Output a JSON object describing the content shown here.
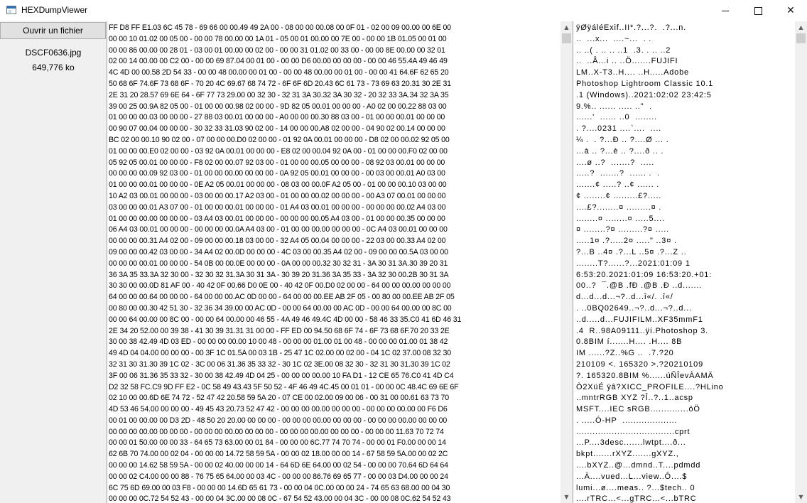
{
  "window": {
    "title": "HEXDumpViewer",
    "controls": {
      "minimize": "",
      "maximize": "",
      "close": "✕"
    }
  },
  "sidebar": {
    "open_button_label": "Ouvrir un fichier",
    "file_name": "DSCF0636.jpg",
    "file_size": "649,776 ko"
  },
  "hex_lines": [
    "FF D8 FF E1.03 6C 45 78 - 69 66 00 00.49 49 2A 00 - 08 00 00 00.08 00 0F 01 - 02 00 09 00.00 00 6E 00",
    "00 00 10 01.02 00 05 00 - 00 00 78 00.00 00 1A 01 - 05 00 01 00.00 00 7E 00 - 00 00 1B 01.05 00 01 00",
    "00 00 86 00.00 00 28 01 - 03 00 01 00.00 00 02 00 - 00 00 31 01.02 00 33 00 - 00 00 8E 00.00 00 32 01",
    "02 00 14 00.00 00 C2 00 - 00 00 69 87.04 00 01 00 - 00 00 D6 00.00 00 00 00 - 00 00 46 55.4A 49 46 49",
    "4C 4D 00 00.58 2D 54 33 - 00 00 48 00.00 00 01 00 - 00 00 48 00.00 00 01 00 - 00 00 41 64.6F 62 65 20",
    "50 68 6F 74.6F 73 68 6F - 70 20 4C 69.67 68 74 72 - 6F 6F 6D 20.43 6C 61 73 - 73 69 63 20.31 30 2E 31",
    "2E 31 20 28.57 69 6E 64 - 6F 77 73 29.00 00 32 30 - 32 31 3A 30.32 3A 30 32 - 20 32 33 3A.34 32 3A 35",
    "39 00 25 00.9A 82 05 00 - 01 00 00 00.98 02 00 00 - 9D 82 05 00.01 00 00 00 - A0 02 00 00.22 88 03 00",
    "01 00 00 00.03 00 00 00 - 27 88 03 00.01 00 00 00 - A0 00 00 00.30 88 03 00 - 01 00 00 00.01 00 00 00",
    "00 90 07 00.04 00 00 00 - 30 32 33 31.03 90 02 00 - 14 00 00 00.A8 02 00 00 - 04 90 02 00.14 00 00 00",
    "BC 02 00 00.10 90 02 00 - 07 00 00 00.D0 02 00 00 - 01 92 0A 00.01 00 00 00 - D8 02 00 00.02 92 05 00",
    "01 00 00 00.E0 02 00 00 - 03 92 0A 00.01 00 00 00 - E8 02 00 00.04 92 0A 00 - 01 00 00 00.F0 02 00 00",
    "05 92 05 00.01 00 00 00 - F8 02 00 00.07 92 03 00 - 01 00 00 00.05 00 00 00 - 08 92 03 00.01 00 00 00",
    "00 00 00 00.09 92 03 00 - 01 00 00 00.00 00 00 00 - 0A 92 05 00.01 00 00 00 - 00 03 00 00.01 A0 03 00",
    "01 00 00 00.01 00 00 00 - 0E A2 05 00.01 00 00 00 - 08 03 00 00.0F A2 05 00 - 01 00 00 00.10 03 00 00",
    "10 A2 03 00.01 00 00 00 - 03 00 00 00.17 A2 03 00 - 01 00 00 00.02 00 00 00 - 00 A3 07 00.01 00 00 00",
    "03 00 00 00.01 A3 07 00 - 01 00 00 00.01 00 00 00 - 01 A4 03 00.01 00 00 00 - 00 00 00 00.02 A4 03 00",
    "01 00 00 00.00 00 00 00 - 03 A4 03 00.01 00 00 00 - 00 00 00 00.05 A4 03 00 - 01 00 00 00.35 00 00 00",
    "06 A4 03 00.01 00 00 00 - 00 00 00 00.0A A4 03 00 - 01 00 00 00.00 00 00 00 - 0C A4 03 00.01 00 00 00",
    "00 00 00 00.31 A4 02 00 - 09 00 00 00.18 03 00 00 - 32 A4 05 00.04 00 00 00 - 22 03 00 00.33 A4 02 00",
    "09 00 00 00.42 03 00 00 - 34 A4 02 00.0D 00 00 00 - 4C 03 00 00.35 A4 02 00 - 09 00 00 00.5A 03 00 00",
    "00 00 00 00.01 00 00 00 - 54 0B 00 00.0E 00 00 00 - 0A 00 00 00.32 30 32 31 - 3A 30 31 3A.30 39 20 31",
    "36 3A 35 33.3A 32 30 00 - 32 30 32 31.3A 30 31 3A - 30 39 20 31.36 3A 35 33 - 3A 32 30 00.2B 30 31 3A",
    "30 30 00 00.0D 81 AF 00 - 40 42 0F 00.66 D0 0E 00 - 40 42 0F 00.D0 02 00 00 - 64 00 00 00.00 00 00 00",
    "64 00 00 00.64 00 00 00 - 64 00 00 00.AC 0D 00 00 - 64 00 00 00.EE AB 2F 05 - 00 80 00 00.EE AB 2F 05",
    "00 80 00 00.30 42 51 30 - 32 36 34 39.00 00 AC 0D - 00 00 64 00.00 00 AC 0D - 00 00 64 00.00 00 8C 00",
    "00 00 64 00.00 00 8C 00 - 00 00 64 00.00 00 46 55 - 4A 49 46 49.4C 4D 00 00 - 58 46 33 35.C0 41 6D 46 31",
    "2E 34 20 52.00 00 39 38 - 41 30 39 31.31 31 00 00 - FF ED 00 94.50 68 6F 74 - 6F 73 68 6F.70 20 33 2E",
    "30 00 38 42.49 4D 03 ED - 00 00 00 00.00 10 00 48 - 00 00 00 01.00 01 00 48 - 00 00 00 01.00 01 38 42",
    "49 4D 04 04.00 00 00 00 - 00 3F 1C 01.5A 00 03 1B - 25 47 1C 02.00 00 02 00 - 04 1C 02 37.00 08 32 30",
    "32 31 30 31.30 39 1C 02 - 3C 00 06 31.36 35 33 32 - 30 1C 02 3E.00 08 32 30 - 32 31 30 31.30 39 1C 02",
    "3F 00 06 31.36 35 33 32 - 30 00 38 42.49 4D 04 25 - 00 00 00 00.00 10 FA D1 - 12 CE 65 76.C0 41 4D C4",
    "D2 32 58 FC.C9 9D FF E2 - 0C 58 49 43.43 5F 50 52 - 4F 46 49 4C.45 00 01 01 - 00 00 0C 48.4C 69 6E 6F",
    "02 10 00 00.6D 6E 74 72 - 52 47 42 20.58 59 5A 20 - 07 CE 00 02.00 09 00 06 - 00 31 00 00.61 63 73 70",
    "4D 53 46 54.00 00 00 00 - 49 45 43 20.73 52 47 42 - 00 00 00 00.00 00 00 00 - 00 00 00 00.00 00 F6 D6",
    "00 01 00 00.00 00 D3 2D - 48 50 20 20.00 00 00 00 - 00 00 00 00.00 00 00 00 - 00 00 00 00.00 00 00 00",
    "00 00 00 00.00 00 00 00 - 00 00 00 00.00 00 00 00 - 00 00 00 00.00 00 00 00 - 00 00 00 11.63 70 72 74",
    "00 00 01 50.00 00 00 33 - 64 65 73 63.00 00 01 84 - 00 00 00 6C.77 74 70 74 - 00 00 01 F0.00 00 00 14",
    "62 6B 70 74.00 00 02 04 - 00 00 00 14.72 58 59 5A - 00 00 02 18.00 00 00 14 - 67 58 59 5A.00 00 02 2C",
    "00 00 00 14.62 58 59 5A - 00 00 02 40.00 00 00 14 - 64 6D 6E 64.00 00 02 54 - 00 00 00 70.64 6D 64 64",
    "00 00 02 C4.00 00 00 88 - 76 75 65 64.00 00 03 4C - 00 00 00 86.76 69 65 77 - 00 00 03 D4.00 00 00 24",
    "6C 75 6D 69.00 00 03 F8 - 00 00 00 14.6D 65 61 73 - 00 00 04 0C.00 00 00 24 - 74 65 63 68.00 00 04 30",
    "00 00 00 0C.72 54 52 43 - 00 00 04 3C.00 00 08 0C - 67 54 52 43.00 00 04 3C - 00 00 08 0C.62 54 52 43"
  ],
  "ascii_lines": [
    "ÿØÿáléExif..II*.?...?.  .?...n.",
    "..  ...x...  ....~...  . .",
    ".. ..( . .. .. ..1  .3. . .. ..2",
    "..  ..Â...i .. ..Ö.......FUJIFI",
    "LM..X-T3..H.... ..H.....Adobe",
    "Photoshop Lightroom Classic 10.1",
    ".1 (Windows)..2021:02:02 23:42:5",
    "9.%.. ...... ..... ..\"  .",
    "......'  ...... ..0  ........",
    ". ?....0231 ....`....  ....",
    "¼ .  . ?...Ð .. ?....Ø ... .",
    "...à .. ?...è .. ?....ð .. .",
    "....ø ..?  .......?  .....",
    ".....?  .......?  ...... .  .",
    ".......¢ .....? ..¢ ...... .",
    "¢ ........¢ .........£?.....",
    "....£?........¤ .........¤ .",
    "........¤ ........¤ .....5....",
    "¤ ........?¤ .........?¤ .....",
    ".....1¤ .?.....2¤ .....\" ..3¤ .",
    "?...B ..4¤ .?...L ..5¤ .?...Z ..",
    "........T?......?...2021:01:09 1",
    "6:53:20.2021:01:09 16:53:20.+01:",
    "00..?  ¯.@B .fÐ .@B .Ð ..d.......",
    "d...d...d...¬?..d...î«/. .î«/",
    ". ..0BQ02649..¬?..d...¬?..d...",
    "..d.....d...FUJIFILM..XF35mmF1",
    ".4  R..98A09111..ÿí.Photoshop 3.",
    "0.8BIM í.......H.... .H.... 8B",
    "IM ......?Z..%G ..  .7.?20",
    "210109 <. 165320 >.?20210109",
    "?. 165320.8BIM %......úÑÎevÀAMÄ",
    "Ò2XüÉ ÿâ?XICC_PROFILE....?HLino",
    "..mntrRGB XYZ ?Î..?..1..acsp",
    "MSFT....IEC sRGB..............öÖ",
    ". .....Ó-HP  ....................",
    "....................................cprt",
    "...P....3desc.......lwtpt....ð...",
    "bkpt.......rXYZ.......gXYZ.,",
    "....bXYZ..@...dmnd..T....pdmdd",
    "...Ä....vued...L...view..Ô....$",
    "lumi...ø....meas.. ?...$tech.. 0",
    "....rTRC...<...gTRC...<...bTRC"
  ]
}
